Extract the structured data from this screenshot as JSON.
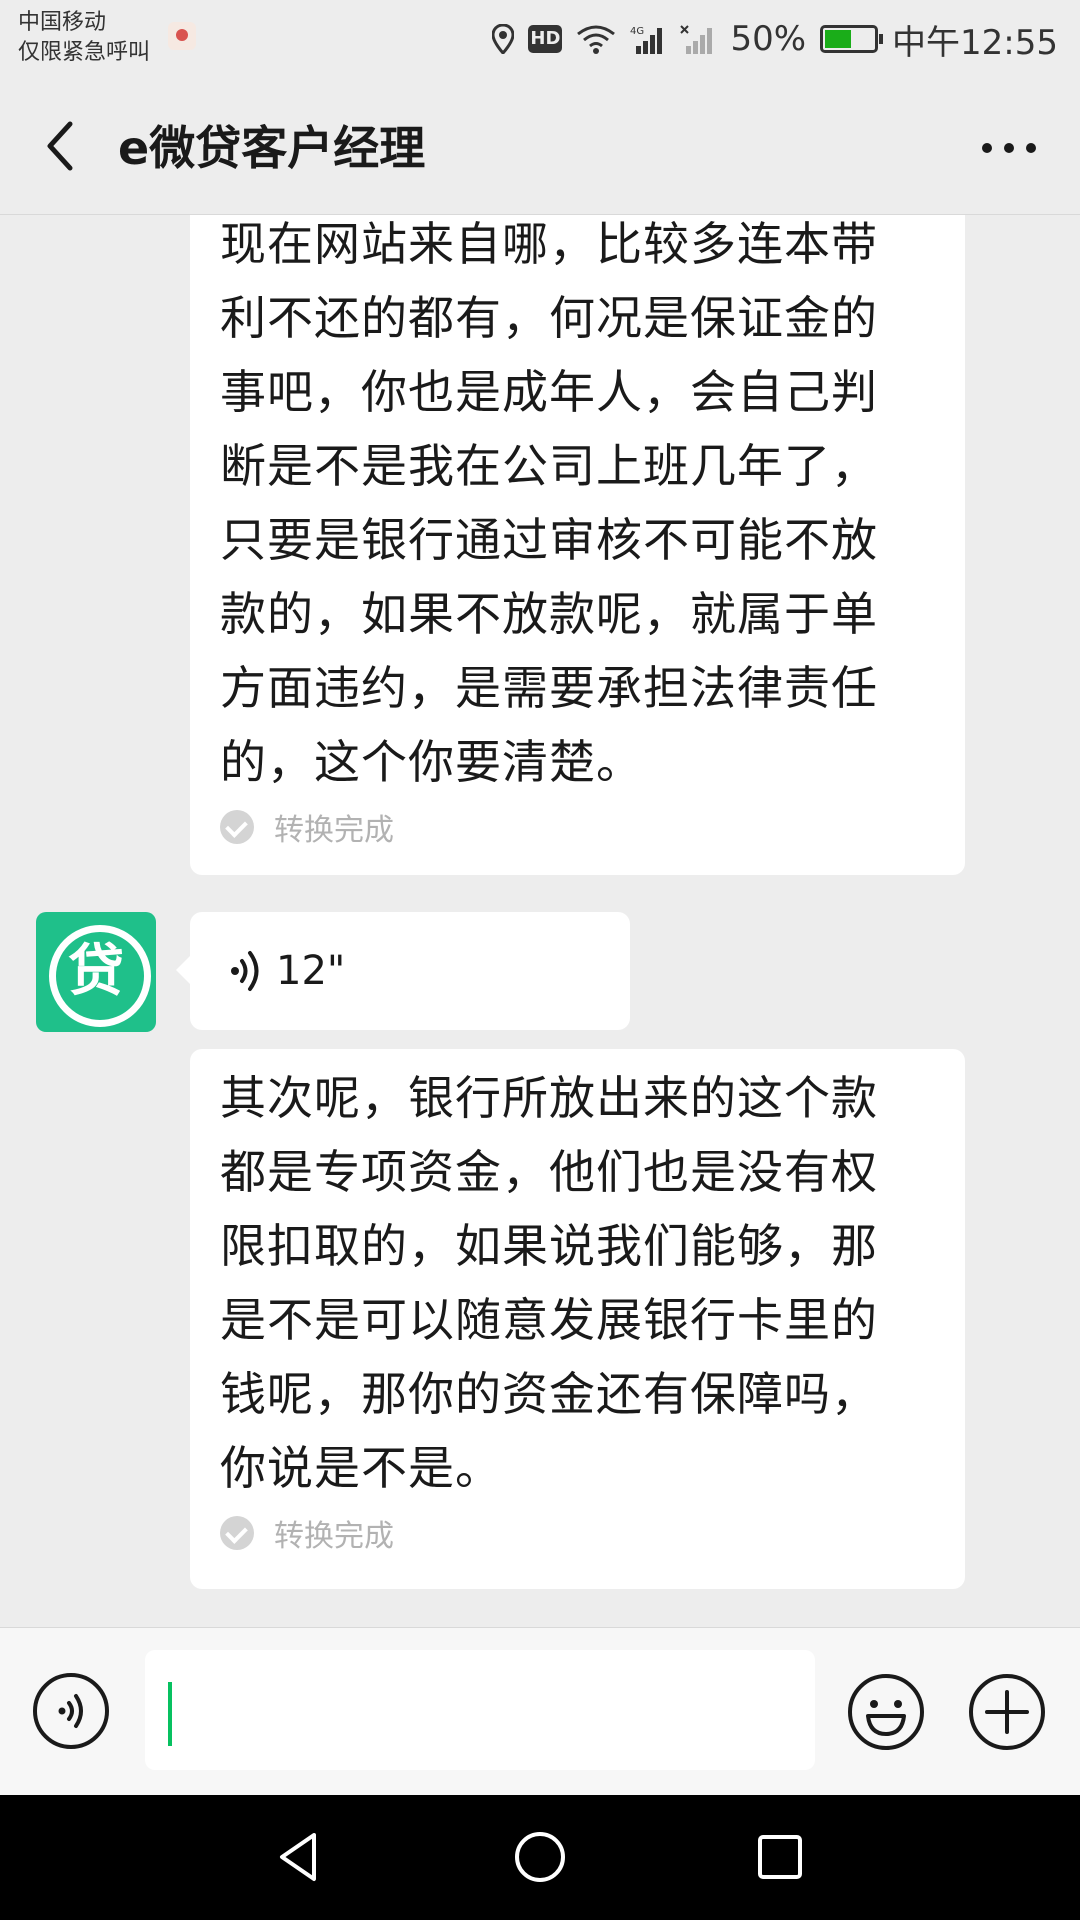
{
  "status_bar": {
    "carrier_line1": "中国移动",
    "carrier_line2": "仅限紧急呼叫",
    "hd_label": "HD",
    "battery": "50%",
    "time": "中午12:55",
    "icons": [
      "sim-icon",
      "location-icon",
      "hd-icon",
      "wifi-icon",
      "signal-4g-icon",
      "signal-nosim-icon",
      "battery-icon"
    ]
  },
  "nav": {
    "title": "e微贷客户经理",
    "back_icon": "chevron-left-icon",
    "more_icon": "more-icon"
  },
  "chat": {
    "messages": [
      {
        "type": "voice-transcript",
        "lines": [
          "现在网站来自哪，比较多连本带",
          "利不还的都有，何况是保证金的",
          "事吧，你也是成年人，会自己判",
          "断是不是我在公司上班几年了，",
          "只要是银行通过审核不可能不放",
          "款的，如果不放款呢，就属于单",
          "方面违约，是需要承担法律责任",
          "的，这个你要清楚。"
        ],
        "status": "转换完成"
      },
      {
        "type": "voice",
        "duration": "12\"",
        "avatar_glyph": "贷",
        "avatar_color": "#1fc08a"
      },
      {
        "type": "voice-transcript",
        "lines": [
          "其次呢，银行所放出来的这个款",
          "都是专项资金，他们也是没有权",
          "限扣取的，如果说我们能够，那",
          "是不是可以随意发展银行卡里的",
          "钱呢，那你的资金还有保障吗，",
          "你说是不是。"
        ],
        "status": "转换完成"
      }
    ]
  },
  "input_bar": {
    "text_value": "",
    "voice_icon": "voice-input-icon",
    "emoji_icon": "emoji-icon",
    "plus_icon": "plus-icon",
    "accent": "#07c160"
  },
  "system_nav": {
    "icons": [
      "back-triangle-icon",
      "home-circle-icon",
      "recents-square-icon"
    ]
  }
}
